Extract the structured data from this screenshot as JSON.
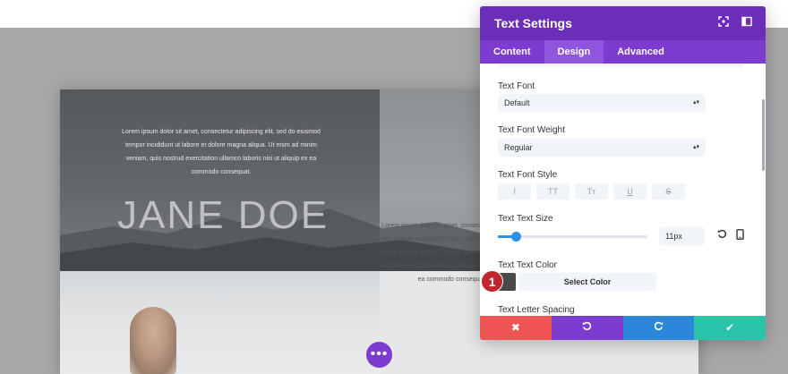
{
  "panel": {
    "title": "Text Settings",
    "tabs": [
      {
        "label": "Content"
      },
      {
        "label": "Design"
      },
      {
        "label": "Advanced"
      }
    ],
    "fields": {
      "text_font_label": "Text Font",
      "text_font_value": "Default",
      "text_font_weight_label": "Text Font Weight",
      "text_font_weight_value": "Regular",
      "text_font_style_label": "Text Font Style",
      "style_buttons": [
        "I",
        "TT",
        "Tт",
        "U",
        "S"
      ],
      "text_size_label": "Text Text Size",
      "text_size_value": "11px",
      "text_size_slider_fraction": 0.12,
      "text_color_label": "Text Text Color",
      "text_color_swatch": "#4a4a4a",
      "select_color_label": "Select Color",
      "letter_spacing_label": "Text Letter Spacing"
    },
    "footer_icons": [
      "close-icon",
      "undo-icon",
      "redo-icon",
      "check-icon"
    ],
    "colors": {
      "header": "#6c2eb9",
      "tabs": "#7e3bd0",
      "cancel": "#ef5555",
      "undo": "#7e3bd0",
      "redo": "#2b87da",
      "save": "#29c4a9"
    }
  },
  "badge": "1",
  "hero": {
    "lorem_top": "Lorem ipsum dolor sit amet, consectetur adipiscing elit, sed do eiusmod tempor incididunt ut labore et dolore magna aliqua. Ut enim ad minim veniam, quis nostrud exercitation ullamco laboris nisi ut aliquip ex ea commodo consequat.",
    "name": "JANE DOE",
    "lorem_bottom": "Lorem ipsum dolor sit amet, consectetur adipiscing elit, sed do eiusmod tempor incididunt ut labore et dolore magna aliqua. Ut enim ad minim veniam, quis nostrud exercitation ullamco laboris nisi ut aliquip ex ea commodo consequat."
  },
  "fab_label": "•••"
}
